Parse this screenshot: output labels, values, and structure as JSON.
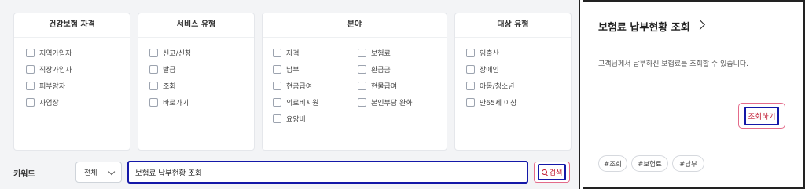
{
  "filters": {
    "insurance_status": {
      "title": "건강보험 자격",
      "options": [
        "지역가입자",
        "직장가입자",
        "피부양자",
        "사업장"
      ]
    },
    "service_type": {
      "title": "서비스 유형",
      "options": [
        "신고/신청",
        "발급",
        "조회",
        "바로가기"
      ]
    },
    "field": {
      "title": "분야",
      "options_left": [
        "자격",
        "납부",
        "현금급여",
        "의료비지원",
        "요양비"
      ],
      "options_right": [
        "보험료",
        "환급금",
        "현물급여",
        "본인부담 완화"
      ]
    },
    "target_type": {
      "title": "대상 유형",
      "options": [
        "임출산",
        "장애인",
        "아동/청소년",
        "만65세 이상"
      ]
    }
  },
  "keyword": {
    "label": "키워드",
    "scope": "전체",
    "value": "보험료 납부현황 조회",
    "search_label": "검색"
  },
  "service_card": {
    "title": "보험료 납부현황 조회",
    "description": "고객님께서 납부하신 보험료를 조회할 수 있습니다.",
    "button_label": "조회하기",
    "tags": [
      "#조회",
      "#보험료",
      "#납부"
    ]
  },
  "colors": {
    "highlight_blue": "#1418a8",
    "accent_red": "#c0172f",
    "panel_gray": "#f3f4f6"
  }
}
